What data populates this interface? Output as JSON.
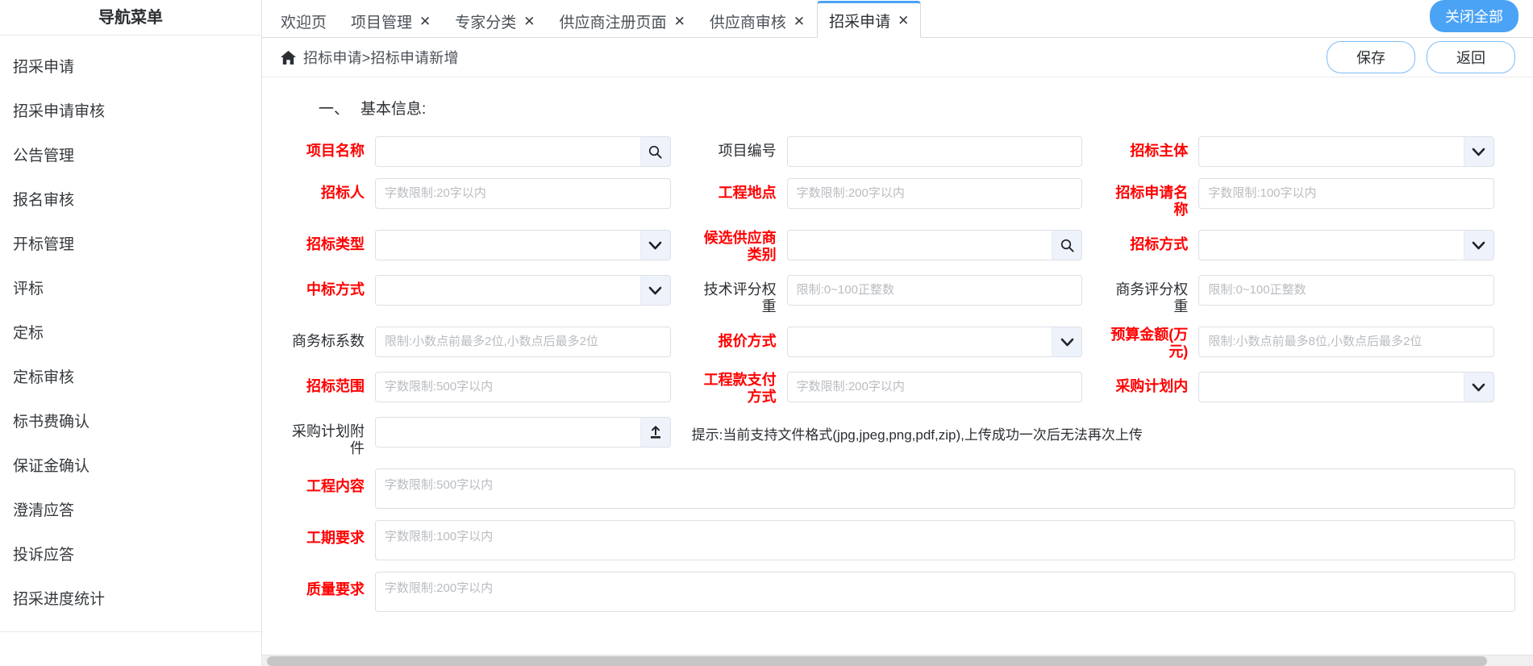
{
  "sidebar": {
    "title": "导航菜单",
    "items": [
      {
        "label": "招采申请"
      },
      {
        "label": "招采申请审核"
      },
      {
        "label": "公告管理"
      },
      {
        "label": "报名审核"
      },
      {
        "label": "开标管理"
      },
      {
        "label": "评标"
      },
      {
        "label": "定标"
      },
      {
        "label": "定标审核"
      },
      {
        "label": "标书费确认"
      },
      {
        "label": "保证金确认"
      },
      {
        "label": "澄清应答"
      },
      {
        "label": "投诉应答"
      },
      {
        "label": "招采进度统计"
      }
    ]
  },
  "tabbar": {
    "menu_icon": "hamburger-icon",
    "close_all_label": "关闭全部",
    "close_glyph": "✕",
    "tabs": [
      {
        "label": "欢迎页",
        "closable": false,
        "active": false
      },
      {
        "label": "项目管理",
        "closable": true,
        "active": false
      },
      {
        "label": "专家分类",
        "closable": true,
        "active": false
      },
      {
        "label": "供应商注册页面",
        "closable": true,
        "active": false
      },
      {
        "label": "供应商审核",
        "closable": true,
        "active": false
      },
      {
        "label": "招采申请",
        "closable": true,
        "active": true
      }
    ]
  },
  "breadcrumb": {
    "home_icon": "home-icon",
    "path": "招标申请>招标申请新增",
    "save_label": "保存",
    "back_label": "返回"
  },
  "form": {
    "section_number": "一、",
    "section_title": "基本信息:",
    "upload_hint": "提示:当前支持文件格式(jpg,jpeg,png,pdf,zip),上传成功一次后无法再次上传",
    "fields": {
      "project_name": {
        "label": "项目名称",
        "required": true,
        "type": "search",
        "value": "",
        "placeholder": ""
      },
      "project_code": {
        "label": "项目编号",
        "required": false,
        "type": "text",
        "value": "",
        "placeholder": ""
      },
      "bid_subject": {
        "label": "招标主体",
        "required": true,
        "type": "select",
        "value": "",
        "placeholder": ""
      },
      "bidder": {
        "label": "招标人",
        "required": true,
        "type": "text",
        "value": "",
        "placeholder": "字数限制:20字以内"
      },
      "project_site": {
        "label": "工程地点",
        "required": true,
        "type": "text",
        "value": "",
        "placeholder": "字数限制:200字以内"
      },
      "apply_name": {
        "label": "招标申请名称",
        "required": true,
        "type": "text",
        "value": "",
        "placeholder": "字数限制:100字以内"
      },
      "bid_type": {
        "label": "招标类型",
        "required": true,
        "type": "select",
        "value": "",
        "placeholder": ""
      },
      "candidate_cat": {
        "label": "候选供应商类别",
        "required": true,
        "type": "search",
        "value": "",
        "placeholder": ""
      },
      "bid_method": {
        "label": "招标方式",
        "required": true,
        "type": "select",
        "value": "",
        "placeholder": ""
      },
      "award_method": {
        "label": "中标方式",
        "required": true,
        "type": "select",
        "value": "",
        "placeholder": ""
      },
      "tech_weight": {
        "label": "技术评分权重",
        "required": false,
        "type": "text",
        "value": "",
        "placeholder": "限制:0~100正整数"
      },
      "biz_weight": {
        "label": "商务评分权重",
        "required": false,
        "type": "text",
        "value": "",
        "placeholder": "限制:0~100正整数"
      },
      "biz_coef": {
        "label": "商务标系数",
        "required": false,
        "type": "text",
        "value": "",
        "placeholder": "限制:小数点前最多2位,小数点后最多2位"
      },
      "quote_method": {
        "label": "报价方式",
        "required": true,
        "type": "select",
        "value": "",
        "placeholder": ""
      },
      "budget_amount": {
        "label": "预算金额(万元)",
        "required": true,
        "type": "text",
        "value": "",
        "placeholder": "限制:小数点前最多8位,小数点后最多2位"
      },
      "bid_scope": {
        "label": "招标范围",
        "required": true,
        "type": "text",
        "value": "",
        "placeholder": "字数限制:500字以内"
      },
      "payment_method": {
        "label": "工程款支付方式",
        "required": true,
        "type": "text",
        "value": "",
        "placeholder": "字数限制:200字以内"
      },
      "in_plan": {
        "label": "采购计划内",
        "required": true,
        "type": "select",
        "value": "",
        "placeholder": ""
      },
      "plan_attachment": {
        "label": "采购计划附件",
        "required": false,
        "type": "upload",
        "value": "",
        "placeholder": ""
      },
      "project_content": {
        "label": "工程内容",
        "required": true,
        "type": "textarea",
        "value": "",
        "placeholder": "字数限制:500字以内"
      },
      "duration_req": {
        "label": "工期要求",
        "required": true,
        "type": "textarea",
        "value": "",
        "placeholder": "字数限制:100字以内"
      },
      "quality_req": {
        "label": "质量要求",
        "required": true,
        "type": "textarea",
        "value": "",
        "placeholder": "字数限制:200字以内"
      }
    }
  },
  "icons": {
    "search": "search-icon",
    "chevron_down": "chevron-down-icon",
    "upload": "upload-icon"
  },
  "colors": {
    "accent": "#4aa3f5",
    "required_label": "#ff0000",
    "border": "#dcdfe6",
    "suffix_bg": "#eef3fb"
  }
}
